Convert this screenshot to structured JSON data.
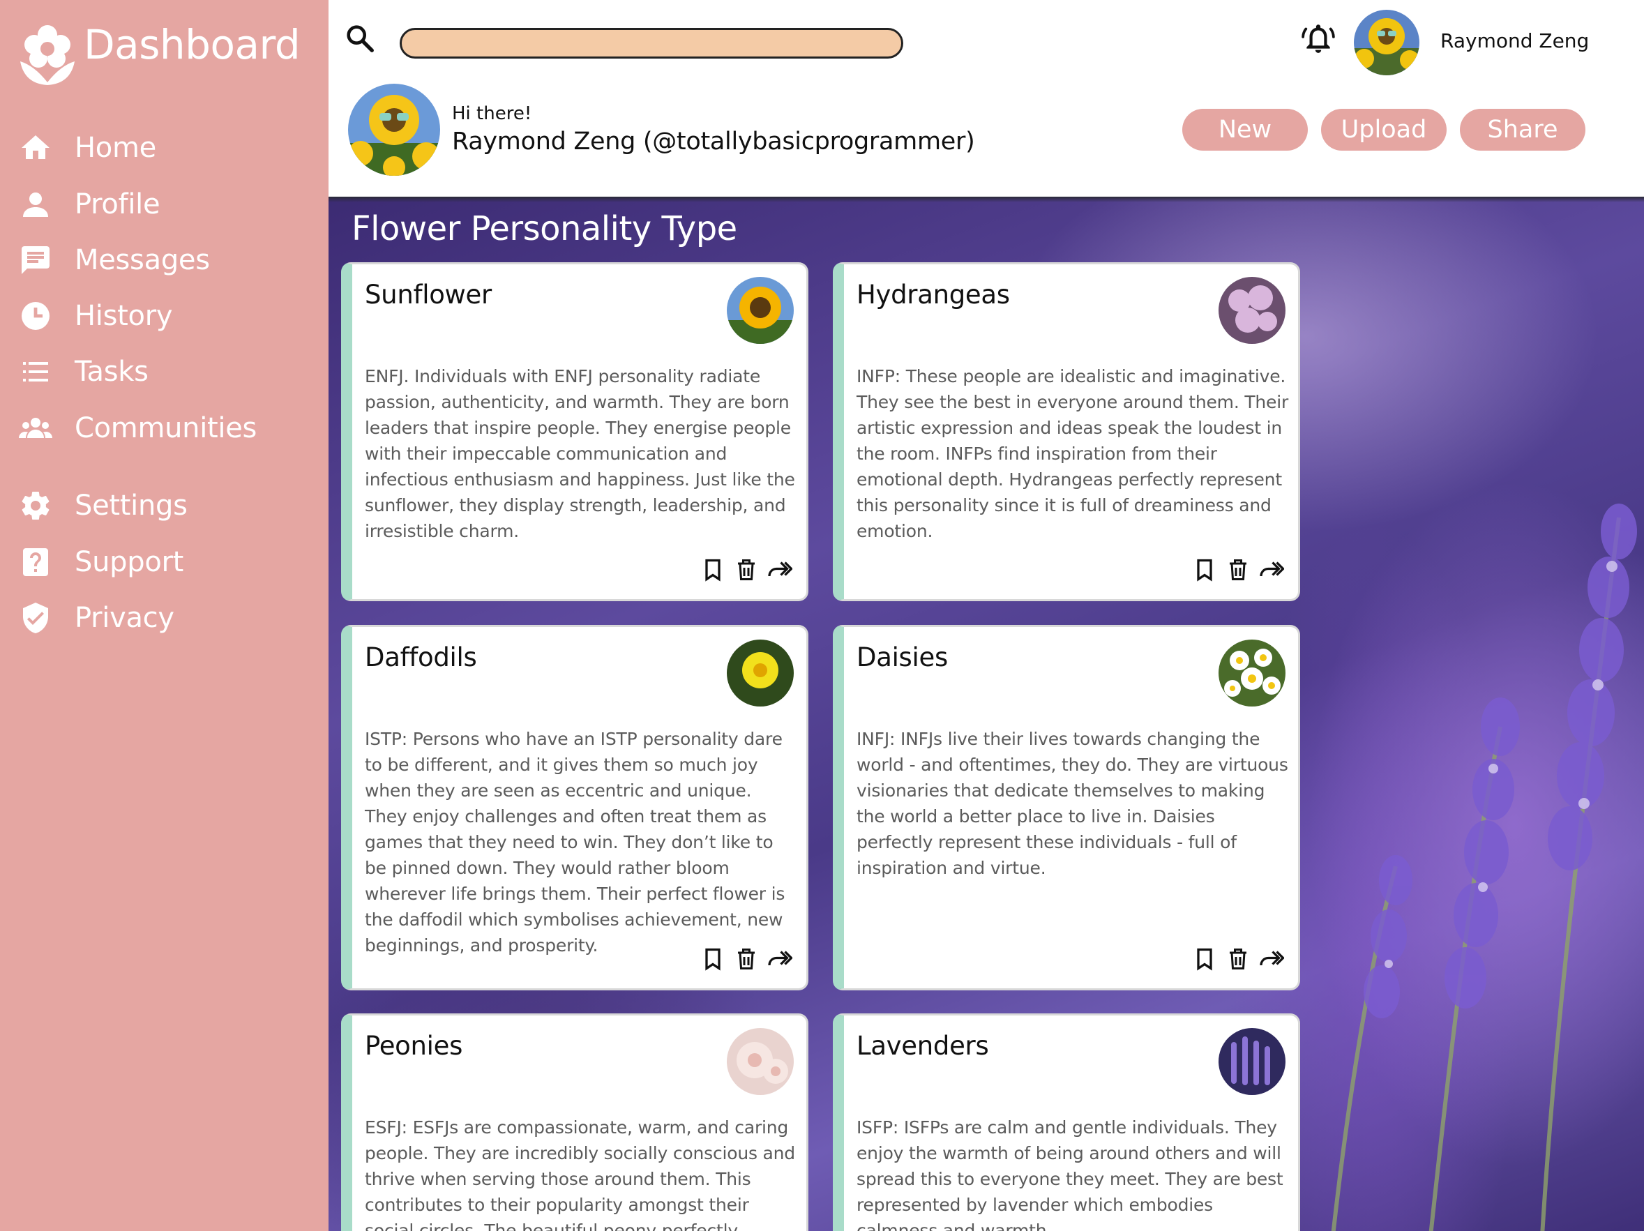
{
  "sidebar": {
    "brand": "Dashboard",
    "items": [
      {
        "label": "Home",
        "icon": "home-icon"
      },
      {
        "label": "Profile",
        "icon": "person-icon"
      },
      {
        "label": "Messages",
        "icon": "message-icon"
      },
      {
        "label": "History",
        "icon": "clock-icon"
      },
      {
        "label": "Tasks",
        "icon": "list-icon"
      },
      {
        "label": "Communities",
        "icon": "group-icon"
      },
      {
        "label": "Settings",
        "icon": "gear-icon"
      },
      {
        "label": "Support",
        "icon": "help-icon"
      },
      {
        "label": "Privacy",
        "icon": "shield-icon"
      }
    ]
  },
  "header": {
    "search": {
      "value": "",
      "placeholder": ""
    },
    "username": "Raymond Zeng",
    "greeting": "Hi there!",
    "handle": "Raymond Zeng (@totallybasicprogrammer)",
    "buttons": {
      "new": "New",
      "upload": "Upload",
      "share": "Share"
    }
  },
  "main": {
    "section_title": "Flower Personality Type",
    "cards": [
      {
        "title": "Sunflower",
        "image": "sunflower-image",
        "text": "ENFJ. Individuals with ENFJ personality radiate passion, authenticity, and warmth. They are born leaders that inspire people. They energise people with their impeccable communication and infectious enthusiasm and happiness. Just like the sunflower, they display strength, leadership, and irresistible charm."
      },
      {
        "title": "Hydrangeas",
        "image": "hydrangea-image",
        "text": "INFP: These people are idealistic and imaginative. They see the best in everyone around them. Their artistic expression and ideas speak the loudest in the room. INFPs find inspiration from their emotional depth. Hydrangeas perfectly represent this personality since it is full of dreaminess and emotion."
      },
      {
        "title": "Daffodils",
        "image": "daffodil-image",
        "text": "ISTP: Persons who have an ISTP personality dare to be different, and it gives them so much joy when they are seen as eccentric and unique. They enjoy challenges and often treat them as games that they need to win. They don’t like to be pinned down. They would rather bloom wherever life brings them. Their perfect flower is the daffodil which symbolises achievement, new beginnings, and prosperity."
      },
      {
        "title": "Daisies",
        "image": "daisy-image",
        "text": "INFJ: INFJs live their lives towards changing the world - and oftentimes, they do. They are virtuous visionaries that dedicate themselves to making the world a better place to live in. Daisies perfectly represent these individuals - full of inspiration and virtue."
      },
      {
        "title": "Peonies",
        "image": "peony-image",
        "text": "ESFJ: ESFJs are compassionate, warm, and caring people. They are incredibly socially conscious and thrive when serving those around them. This contributes to their popularity amongst their social circles. The beautiful peony perfectly embodies"
      },
      {
        "title": "Lavenders",
        "image": "lavender-image",
        "text": "ISFP: ISFPs are calm and gentle individuals. They enjoy the warmth of being around others and will spread this to everyone they meet. They are best represented by lavender which embodies calmness and warmth."
      }
    ]
  },
  "colors": {
    "sidebar": "#e5a6a2",
    "search_fill": "#f4cba6",
    "card_accent": "#a9dcc9",
    "button": "#e5a6a2"
  }
}
